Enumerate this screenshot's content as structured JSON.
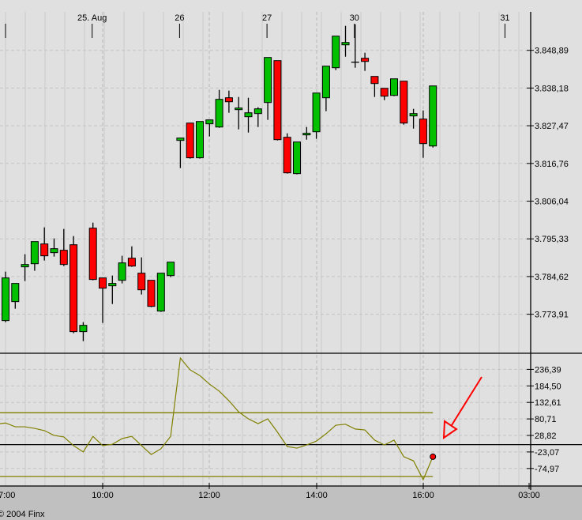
{
  "chart_data": [
    {
      "type": "candlestick",
      "title": "",
      "price_axis": {
        "ticks": [
          3848.89,
          3838.18,
          3827.47,
          3816.76,
          3806.04,
          3795.33,
          3784.62,
          3773.91
        ],
        "tick_labels": [
          "3.848,89",
          "3.838,18",
          "3.827,47",
          "3.816,76",
          "3.806,04",
          "3.795,33",
          "3.784,62",
          "3.773,91"
        ]
      },
      "date_axis": {
        "labels": [
          "25. Aug",
          "26",
          "27",
          "30",
          "31"
        ],
        "label_candle_index": [
          9,
          18,
          27,
          36,
          51.5
        ]
      },
      "colors": {
        "up": "#00c000",
        "down": "#ff0000",
        "outline": "#000000"
      },
      "candles": [
        [
          3772.11,
          3786.03,
          3771.66,
          3784.23
        ],
        [
          3777.5,
          3782.67,
          3775.48,
          3782.67
        ],
        [
          3787.38,
          3790.96,
          3783.34,
          3788.05
        ],
        [
          3788.27,
          3794.56,
          3786.26,
          3794.56
        ],
        [
          3793.88,
          3798.6,
          3789.17,
          3790.52
        ],
        [
          3791.42,
          3795.46,
          3790.29,
          3792.54
        ],
        [
          3792.09,
          3798.15,
          3787.6,
          3788.05
        ],
        [
          3793.66,
          3796.13,
          3768.52,
          3768.97
        ],
        [
          3768.97,
          3771.66,
          3766.27,
          3770.76
        ],
        [
          3798.37,
          3799.94,
          3783.56,
          3783.79
        ],
        [
          3784.23,
          3784.23,
          3771.44,
          3781.32
        ],
        [
          3781.99,
          3784.91,
          3776.82,
          3782.67
        ],
        [
          3783.56,
          3790.52,
          3782.67,
          3788.5
        ],
        [
          3789.84,
          3793.21,
          3787.38,
          3787.6
        ],
        [
          3785.58,
          3790.07,
          3779.52,
          3780.86
        ],
        [
          3783.56,
          3783.56,
          3775.92,
          3776.15
        ],
        [
          3774.81,
          3785.58,
          3774.58,
          3785.58
        ],
        [
          3784.91,
          3788.72,
          3784.46,
          3788.72
        ],
        [
          3823.3,
          3823.97,
          3815.44,
          3823.97
        ],
        [
          3828.23,
          3828.23,
          3818.13,
          3818.37
        ],
        [
          3818.37,
          3828.68,
          3818.13,
          3828.68
        ],
        [
          3828.01,
          3829.13,
          3824.42,
          3829.13
        ],
        [
          3827.11,
          3837.66,
          3826.89,
          3834.97
        ],
        [
          3835.42,
          3837.44,
          3831.15,
          3834.29
        ],
        [
          3832.05,
          3835.64,
          3826.44,
          3832.5
        ],
        [
          3830.03,
          3835.42,
          3825.54,
          3831.15
        ],
        [
          3830.93,
          3832.72,
          3827.11,
          3832.27
        ],
        [
          3834.07,
          3846.87,
          3829.13,
          3846.87
        ],
        [
          3845.97,
          3845.97,
          3823.3,
          3823.52
        ],
        [
          3824.19,
          3825.32,
          3813.87,
          3814.09
        ],
        [
          3813.87,
          3822.85,
          3813.65,
          3822.85
        ],
        [
          3824.87,
          3827.11,
          3823.52,
          3825.32
        ],
        [
          3825.76,
          3836.76,
          3823.75,
          3836.76
        ],
        [
          3835.42,
          3844.4,
          3831.6,
          3844.4
        ],
        [
          3843.95,
          3852.93,
          3843.27,
          3852.93
        ],
        [
          3850.46,
          3855.85,
          3847.09,
          3851.13
        ],
        [
          3845.52,
          3856.3,
          3843.95,
          3845.52
        ],
        [
          3846.64,
          3848.21,
          3843.05,
          3845.74
        ],
        [
          3841.48,
          3841.48,
          3835.64,
          3839.46
        ],
        [
          3838.11,
          3838.11,
          3834.74,
          3835.87
        ],
        [
          3836.09,
          3840.8,
          3835.87,
          3840.8
        ],
        [
          3840.13,
          3840.13,
          3827.78,
          3828.23
        ],
        [
          3830.26,
          3832.27,
          3826.66,
          3830.93
        ],
        [
          3829.36,
          3831.82,
          3818.37,
          3822.4
        ],
        [
          3821.72,
          3838.78,
          3821.28,
          3838.78
        ]
      ]
    },
    {
      "type": "line",
      "title": "",
      "yaxis": {
        "ticks": [
          236.39,
          184.5,
          132.61,
          80.71,
          28.82,
          -23.07,
          -74.97
        ],
        "tick_labels": [
          "236,39",
          "184,50",
          "132,61",
          "80,71",
          "28,82",
          "-23,07",
          "-74,97"
        ]
      },
      "reference_lines": [
        100,
        0,
        -100
      ],
      "colors": {
        "line": "#808000",
        "zero": "#000000",
        "last_point": "#ff0000",
        "annotation_arrow": "#ff0000"
      },
      "values": [
        68,
        56,
        56,
        51,
        44,
        29,
        24,
        -3,
        -23,
        26,
        -3,
        1,
        19,
        26,
        -3,
        -31,
        -13,
        26,
        272,
        235,
        217,
        190,
        168,
        138,
        103,
        81,
        66,
        81,
        39,
        -6,
        -11,
        -1,
        11,
        34,
        61,
        64,
        49,
        46,
        14,
        -1,
        14,
        -38,
        -51,
        -110,
        -38
      ]
    }
  ],
  "time_axis": {
    "labels": [
      "7:00",
      "10:00",
      "12:00",
      "14:00",
      "16:00",
      "03:00"
    ]
  },
  "footer": {
    "copyright": "© 2004 Finx"
  }
}
